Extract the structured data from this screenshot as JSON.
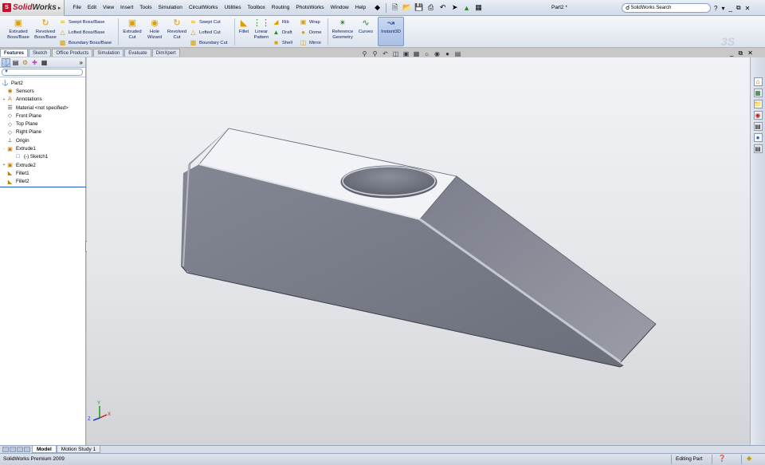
{
  "app": {
    "brand_prefix": "Solid",
    "brand_suffix": "Works",
    "document_title": "Part2 *",
    "search_placeholder": "SolidWorks Search"
  },
  "menu": [
    "File",
    "Edit",
    "View",
    "Insert",
    "Tools",
    "Simulation",
    "CircuitWorks",
    "Utilities",
    "Toolbox",
    "Routing",
    "PhotoWorks",
    "Window",
    "Help"
  ],
  "command_manager": {
    "extruded_boss": "Extruded Boss/Base",
    "revolved_boss": "Revolved Boss/Base",
    "swept_boss": "Swept Boss/Base",
    "lofted_boss": "Lofted Boss/Base",
    "boundary_boss": "Boundary Boss/Base",
    "extruded_cut": "Extruded Cut",
    "hole_wizard": "Hole Wizard",
    "revolved_cut": "Revolved Cut",
    "swept_cut": "Swept Cut",
    "lofted_cut": "Lofted Cut",
    "boundary_cut": "Boundary Cut",
    "fillet": "Fillet",
    "linear_pattern": "Linear Pattern",
    "rib": "Rib",
    "draft": "Draft",
    "shell": "Shell",
    "wrap": "Wrap",
    "dome": "Dome",
    "mirror": "Mirror",
    "reference_geometry": "Reference Geometry",
    "curves": "Curves",
    "instant3d": "Instant3D"
  },
  "tabs": [
    {
      "label": "Features",
      "active": true
    },
    {
      "label": "Sketch",
      "active": false
    },
    {
      "label": "Office Products",
      "active": false
    },
    {
      "label": "Simulation",
      "active": false
    },
    {
      "label": "Evaluate",
      "active": false
    },
    {
      "label": "DimXpert",
      "active": false
    }
  ],
  "feature_tree": {
    "root": "Part2",
    "items": [
      {
        "label": "Sensors",
        "icon": "sensor-icon",
        "expander": "",
        "indent": 1
      },
      {
        "label": "Annotations",
        "icon": "annotation-icon",
        "expander": "+",
        "indent": 1
      },
      {
        "label": "Material <not specified>",
        "icon": "material-icon",
        "expander": "",
        "indent": 1
      },
      {
        "label": "Front Plane",
        "icon": "plane-icon",
        "expander": "",
        "indent": 1
      },
      {
        "label": "Top Plane",
        "icon": "plane-icon",
        "expander": "",
        "indent": 1
      },
      {
        "label": "Right Plane",
        "icon": "plane-icon",
        "expander": "",
        "indent": 1
      },
      {
        "label": "Origin",
        "icon": "origin-icon",
        "expander": "",
        "indent": 1
      },
      {
        "label": "Extrude1",
        "icon": "extrude-icon",
        "expander": "-",
        "indent": 1
      },
      {
        "label": "(-) Sketch1",
        "icon": "sketch-icon",
        "expander": "",
        "indent": 2
      },
      {
        "label": "Extrude2",
        "icon": "extrude-icon",
        "expander": "+",
        "indent": 1
      },
      {
        "label": "Fillet1",
        "icon": "fillet-icon",
        "expander": "",
        "indent": 1
      },
      {
        "label": "Fillet2",
        "icon": "fillet-icon",
        "expander": "",
        "indent": 1
      }
    ]
  },
  "bottom_tabs": [
    {
      "label": "Model",
      "active": true
    },
    {
      "label": "Motion Study 1",
      "active": false
    }
  ],
  "status": {
    "product": "SolidWorks Premium 2009",
    "mode": "Editing Part"
  },
  "colors": {
    "brand_red": "#c8102e",
    "part_gray": "#7d808c",
    "part_top": "#f4f5f8"
  },
  "triad": {
    "x": "X",
    "y": "Y",
    "z": "Z"
  }
}
